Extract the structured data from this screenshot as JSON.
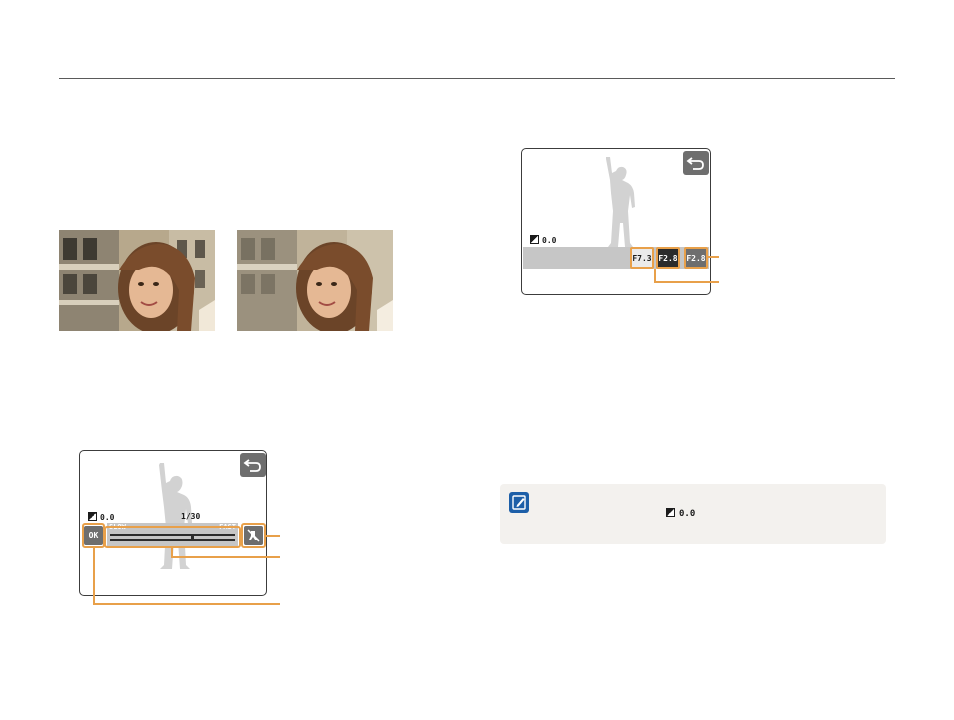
{
  "screen1": {
    "ev_value": "0.0",
    "shutter_value": "1/30",
    "slow_label": "SLOW",
    "fast_label": "FAST",
    "ok_label": "OK"
  },
  "screen2": {
    "ev_value": "0.0",
    "aperture_options": [
      "F7.3",
      "F2.8"
    ],
    "aperture_selected": "F2.8",
    "aperture_current": "F2.8"
  },
  "note": {
    "ev_value": "0.0"
  },
  "colors": {
    "callout": "#e8a04a",
    "note_icon": "#1d5fa8"
  }
}
